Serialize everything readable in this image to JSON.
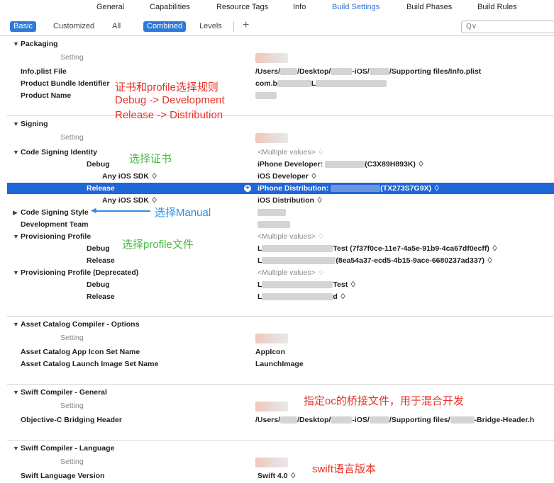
{
  "tabs": [
    "General",
    "Capabilities",
    "Resource Tags",
    "Info",
    "Build Settings",
    "Build Phases",
    "Build Rules"
  ],
  "filters": {
    "basic": "Basic",
    "customized": "Customized",
    "all": "All",
    "combined": "Combined",
    "levels": "Levels"
  },
  "search": {
    "placeholder": "Q∨"
  },
  "packaging": {
    "header": "Packaging",
    "setting": "Setting",
    "info_plist_label": "Info.plist File",
    "info_plist_value_a": "/Users/",
    "info_plist_value_b": "/Desktop/",
    "info_plist_value_c": "-iOS/",
    "info_plist_value_d": "/Supporting files/Info.plist",
    "bundle_id_label": "Product Bundle Identifier",
    "bundle_id_value_a": "com.b",
    "bundle_id_value_b": "L",
    "product_name_label": "Product Name"
  },
  "signing": {
    "header": "Signing",
    "setting": "Setting",
    "identity_label": "Code Signing Identity",
    "identity_value": "<Multiple values> ♢",
    "debug_label": "Debug",
    "debug_value_a": "iPhone Developer: ",
    "debug_value_b": "(C3X89H893K) ♢",
    "any_sdk_label": "Any iOS SDK ♢",
    "any_sdk_debug_value": "iOS Developer ♢",
    "release_label": "Release",
    "release_value_a": "iPhone Distribution: ",
    "release_value_b": "(TX273S7G9X) ♢",
    "any_sdk_release_value": "iOS Distribution ♢",
    "style_label": "Code Signing Style",
    "team_label": "Development Team",
    "profile_label": "Provisioning Profile",
    "profile_value": "<Multiple values> ♢",
    "profile_debug_label": "Debug",
    "profile_debug_value_a": "L",
    "profile_debug_value_b": "Test (7f37f0ce-11e7-4a5e-91b9-4ca67df0ecff) ♢",
    "profile_release_label": "Release",
    "profile_release_value_a": "L",
    "profile_release_value_b": "(8ea54a37-ecd5-4b15-9ace-6680237ad337) ♢",
    "profile_dep_label": "Provisioning Profile (Deprecated)",
    "profile_dep_value": "<Multiple values> ♢",
    "profile_dep_debug_label": "Debug",
    "profile_dep_debug_value_a": "L",
    "profile_dep_debug_value_b": "Test ♢",
    "profile_dep_release_label": "Release",
    "profile_dep_release_value_a": "L",
    "profile_dep_release_value_b": "d ♢"
  },
  "asset_catalog": {
    "header": "Asset Catalog Compiler - Options",
    "setting": "Setting",
    "app_icon_label": "Asset Catalog App Icon Set Name",
    "app_icon_value": "AppIcon",
    "launch_label": "Asset Catalog Launch Image Set Name",
    "launch_value": "LaunchImage"
  },
  "swift_general": {
    "header": "Swift Compiler - General",
    "setting": "Setting",
    "bridging_label": "Objective-C Bridging Header",
    "bridging_value_a": "/Users/",
    "bridging_value_b": "/Desktop/",
    "bridging_value_c": "-iOS/",
    "bridging_value_d": "/Supporting files/",
    "bridging_value_e": "-Bridge-Header.h"
  },
  "swift_language": {
    "header": "Swift Compiler - Language",
    "setting": "Setting",
    "version_label": "Swift Language Version",
    "version_value": "Swift 4.0 ♢"
  },
  "annotations": {
    "rule_line1": "证书和profile选择规则",
    "rule_line2": "Debug -> Development",
    "rule_line3": "Release -> Distribution",
    "choose_cert": "选择证书",
    "choose_manual": "选择Manual",
    "choose_profile": "选择profile文件",
    "bridging_note": "指定oc的桥接文件，用于混合开发",
    "swift_version_note": "swift语言版本"
  },
  "colors": {
    "accent": "#2f7ad9",
    "selected_row": "#1f66d6",
    "annotation_red": "#e8322a",
    "annotation_green": "#4cb848",
    "annotation_blue": "#2d8ee8"
  }
}
